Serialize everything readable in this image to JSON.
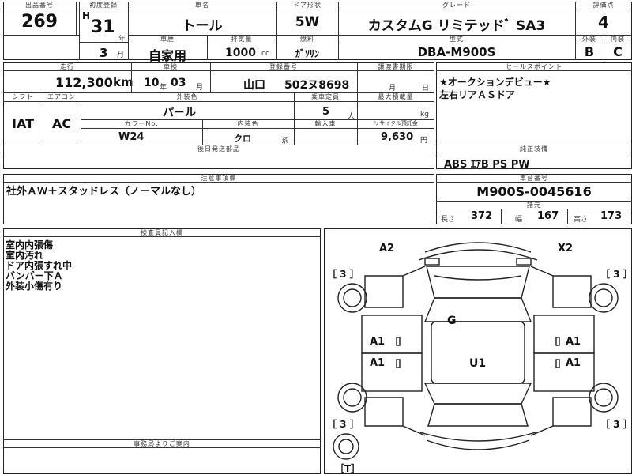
{
  "top": {
    "lot_label": "出品番号",
    "lot": "269",
    "first_reg_label": "初度登録",
    "era": "H",
    "year": "31",
    "year_unit": "年",
    "month": "3",
    "month_unit": "月",
    "name_label": "車名",
    "name": "トール",
    "door_label": "ドア形状",
    "door": "5W",
    "grade_label": "グレード",
    "grade": "カスタムG リミテッドﾞ SA3",
    "score_label": "評価点",
    "score": "4",
    "history_label": "車歴",
    "history": "自家用",
    "disp_label": "排気量",
    "disp": "1000",
    "disp_unit": "cc",
    "fuel_label": "燃料",
    "fuel": "ｶﾞｿﾘﾝ",
    "model_label": "型式",
    "model": "DBA-M900S",
    "ext_label": "外装",
    "int_label": "内装",
    "ext": "B",
    "int": "C"
  },
  "mid": {
    "mileage_label": "走行",
    "mileage": "112,300",
    "mileage_unit": "km",
    "inspection_label": "車検",
    "insp_year": "10",
    "insp_year_unit": "年",
    "insp_month": "03",
    "insp_month_unit": "月",
    "reg_label": "登録番号",
    "reg_area": "山口",
    "reg_no": "502ヌ8698",
    "transfer_label": "譲渡書期限",
    "transfer_month_unit": "月",
    "transfer_day_unit": "日",
    "shift_label": "シフト",
    "shift": "IAT",
    "ac_label": "エアコン",
    "ac": "AC",
    "color_label": "外装色",
    "color": "パ－ル",
    "color_no_label": "カラーNo.",
    "color_no": "W24",
    "interior_label": "内装色",
    "interior": "クロ",
    "interior_unit": "系",
    "cap_label": "乗車定員",
    "cap": "5",
    "cap_unit": "人",
    "load_label": "最大積載量",
    "load_unit": "kg",
    "import_label": "輸入車",
    "recycle_label": "リサイクル預託金",
    "recycle": "9,630",
    "recycle_unit": "円",
    "deferred_label": "後日発送部品"
  },
  "sales": {
    "label": "セールスポイント",
    "line1": "★オークションデビュー★",
    "line2": "左右リアＡＳドア"
  },
  "equip": {
    "label": "純正装備",
    "value": "ABS ｴｱB PS PW"
  },
  "caution": {
    "label": "注意事項欄",
    "value": "社外ＡＷ＋スタッドレス（ノーマルなし）"
  },
  "chassis": {
    "label": "車台番号",
    "value": "M900S-0045616"
  },
  "dims": {
    "label": "諸元",
    "len_label": "長さ",
    "len": "372",
    "wid_label": "幅",
    "wid": "167",
    "hgt_label": "高さ",
    "hgt": "173"
  },
  "inspector": {
    "label": "検査員記入欄",
    "notes": [
      "室内内張傷",
      "室内汚れ",
      "ドア内張すれ中",
      "バンパー下Ａ",
      "外装小傷有り"
    ]
  },
  "office": {
    "label": "事務局よりご案内"
  },
  "diagram": {
    "marks": {
      "a2": "A2",
      "x2": "X2",
      "g": "G",
      "u1": "U1",
      "a1": "A1",
      "tire": "［ 3 ］",
      "spare": "［T］"
    }
  }
}
